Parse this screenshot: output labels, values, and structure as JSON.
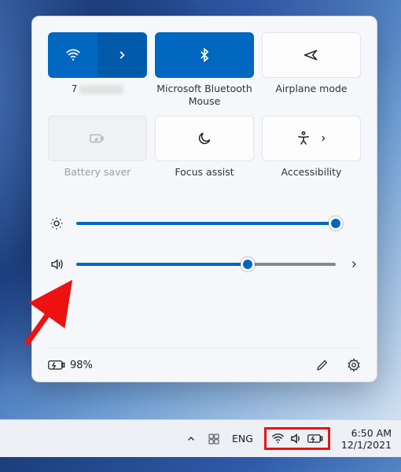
{
  "tiles": {
    "wifi": {
      "label_prefix": "7"
    },
    "bluetooth": {
      "label": "Microsoft Bluetooth Mouse"
    },
    "airplane": {
      "label": "Airplane mode"
    },
    "battery_saver": {
      "label": "Battery saver"
    },
    "focus": {
      "label": "Focus assist"
    },
    "accessibility": {
      "label": "Accessibility"
    }
  },
  "sliders": {
    "brightness": {
      "percent": 100
    },
    "volume": {
      "percent": 66
    }
  },
  "footer": {
    "battery_text": "98%"
  },
  "taskbar": {
    "lang": "ENG",
    "time": "6:50 AM",
    "date": "12/1/2021"
  }
}
